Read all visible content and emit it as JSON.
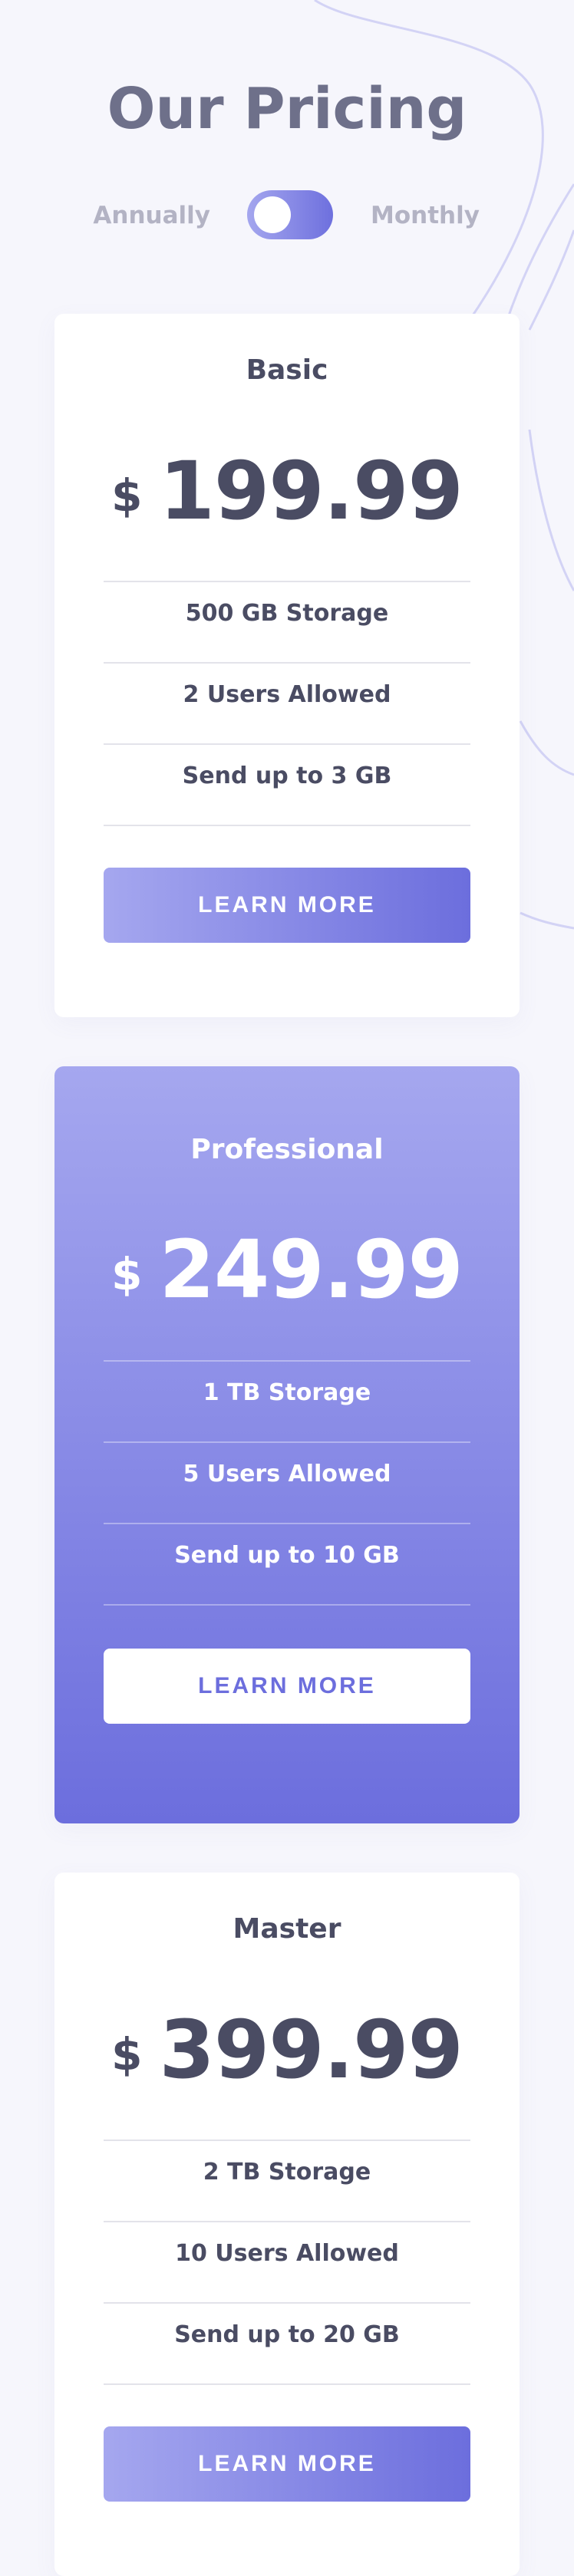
{
  "header": {
    "title": "Our Pricing",
    "toggle": {
      "left_label": "Annually",
      "right_label": "Monthly"
    }
  },
  "plans": [
    {
      "name": "Basic",
      "currency": "$",
      "price": "199.99",
      "features": [
        "500 GB Storage",
        "2 Users Allowed",
        "Send up to 3 GB"
      ],
      "button_label": "LEARN MORE"
    },
    {
      "name": "Professional",
      "currency": "$",
      "price": "249.99",
      "features": [
        "1 TB Storage",
        "5 Users Allowed",
        "Send up to 10 GB"
      ],
      "button_label": "LEARN MORE"
    },
    {
      "name": "Master",
      "currency": "$",
      "price": "399.99",
      "features": [
        "2 TB Storage",
        "10 Users Allowed",
        "Send up to 20 GB"
      ],
      "button_label": "LEARN MORE"
    }
  ],
  "colors": {
    "accent_light": "#a5a7ef",
    "accent_dark": "#6c6edd",
    "background": "#f6f6fc",
    "text_dark": "#4a4c63",
    "text_muted": "#b3b3c4"
  }
}
